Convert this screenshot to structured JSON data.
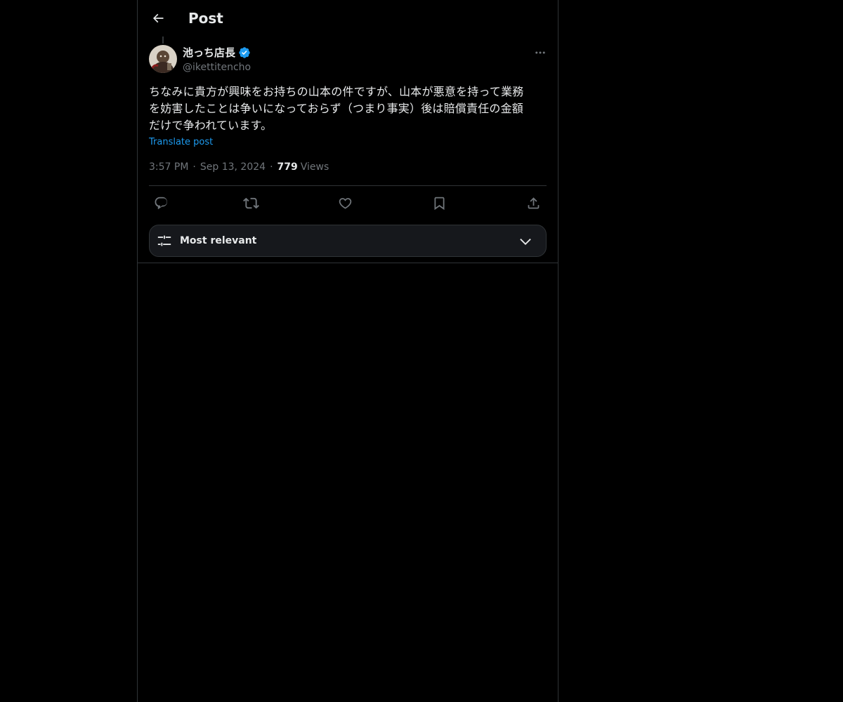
{
  "header": {
    "title": "Post",
    "back_icon": "back-arrow-icon"
  },
  "post": {
    "author": {
      "name": "池っち店長",
      "handle": "@ikettitencho",
      "verified": true,
      "verified_color": "#1d9bf0"
    },
    "text": "ちなみに貴方が興味をお持ちの山本の件ですが、山本が悪意を持って業務\nを妨害したことは争いになっておらず（つまり事実）後は賠償責任の金額\nだけで争われています。",
    "translate_label": "Translate post",
    "time": "3:57 PM",
    "date": "Sep 13, 2024",
    "separator": "·",
    "views_count": "779",
    "views_label": "Views"
  },
  "actions": {
    "reply_icon": "reply-icon",
    "repost_icon": "repost-icon",
    "like_icon": "like-icon",
    "bookmark_icon": "bookmark-icon",
    "share_icon": "share-icon"
  },
  "sort": {
    "label": "Most relevant",
    "icon": "sliders-icon",
    "chevron": "chevron-down-icon"
  },
  "colors": {
    "background": "#000000",
    "text_primary": "#e7e9ea",
    "text_secondary": "#71767b",
    "link": "#1d9bf0",
    "border": "#2f3336"
  }
}
